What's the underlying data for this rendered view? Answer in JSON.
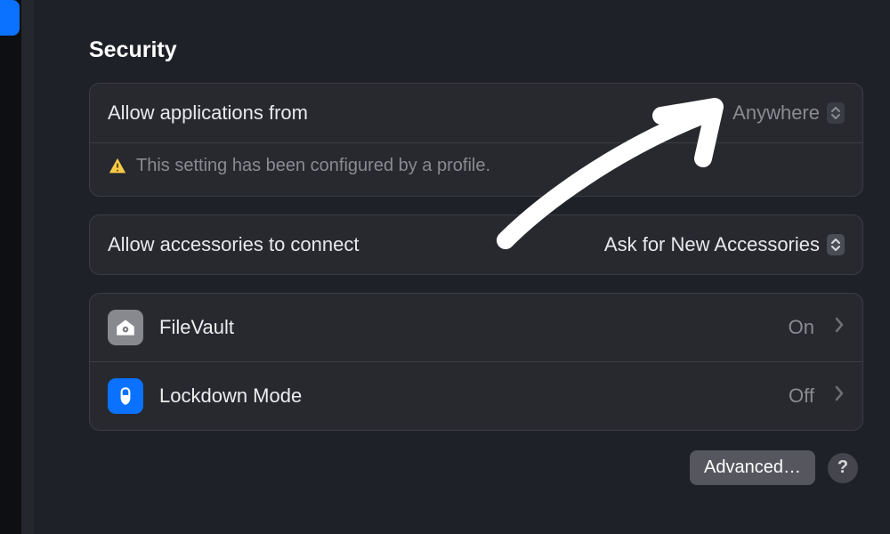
{
  "heading": "Security",
  "allow_apps": {
    "label": "Allow applications from",
    "value": "Anywhere",
    "helper": "This setting has been configured by a profile."
  },
  "accessories": {
    "label": "Allow accessories to connect",
    "value": "Ask for New Accessories"
  },
  "nav": {
    "filevault": {
      "label": "FileVault",
      "state": "On"
    },
    "lockdown": {
      "label": "Lockdown Mode",
      "state": "Off"
    }
  },
  "footer": {
    "advanced": "Advanced…",
    "help": "?"
  }
}
